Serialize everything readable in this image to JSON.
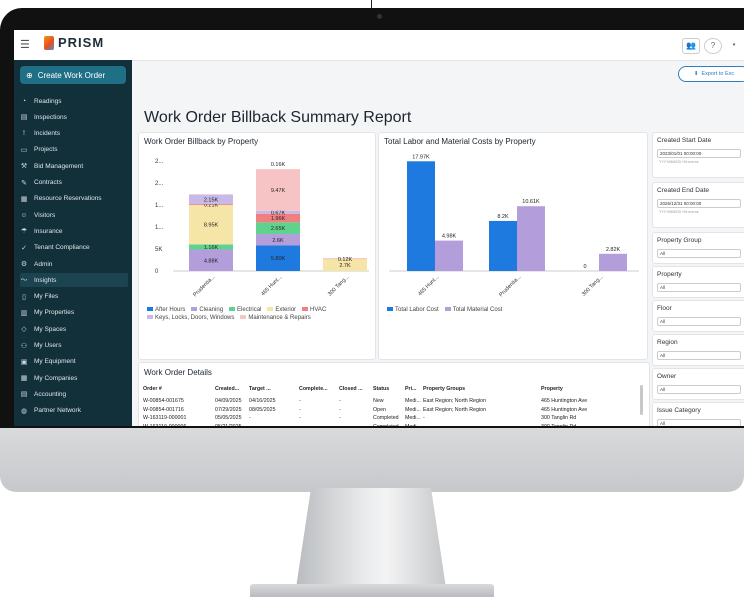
{
  "app": {
    "logo_text": "PRISM",
    "menu_icon": "menu-icon"
  },
  "sidebar": {
    "create_label": "Create Work Order",
    "items": [
      {
        "label": "Readings",
        "icon": "gauge-icon"
      },
      {
        "label": "Inspections",
        "icon": "clipboard-icon"
      },
      {
        "label": "Incidents",
        "icon": "alert-icon"
      },
      {
        "label": "Projects",
        "icon": "folder-icon"
      },
      {
        "label": "Bid Management",
        "icon": "gavel-icon"
      },
      {
        "label": "Contracts",
        "icon": "contract-icon"
      },
      {
        "label": "Resource Reservations",
        "icon": "calendar-icon"
      },
      {
        "label": "Visitors",
        "icon": "visitor-icon"
      },
      {
        "label": "Insurance",
        "icon": "umbrella-icon"
      },
      {
        "label": "Tenant Compliance",
        "icon": "check-circle-icon"
      },
      {
        "label": "Admin",
        "icon": "gear-icon"
      },
      {
        "label": "Insights",
        "icon": "trend-icon"
      },
      {
        "label": "My Files",
        "icon": "file-icon"
      },
      {
        "label": "My Properties",
        "icon": "building-icon"
      },
      {
        "label": "My Spaces",
        "icon": "space-icon"
      },
      {
        "label": "My Users",
        "icon": "users-icon"
      },
      {
        "label": "My Equipment",
        "icon": "equipment-icon"
      },
      {
        "label": "My Companies",
        "icon": "company-icon"
      },
      {
        "label": "Accounting",
        "icon": "ledger-icon"
      },
      {
        "label": "Partner Network",
        "icon": "globe-icon"
      }
    ]
  },
  "header": {
    "export_label": "Export to Exc"
  },
  "report": {
    "title": "Work Order Billback Summary Report"
  },
  "chart_data": [
    {
      "type": "bar",
      "title": "Work Order Billback by Property",
      "stacked": true,
      "categories": [
        "Prudentia...",
        "465 Hunt...",
        "300 Tang..."
      ],
      "y_ticks": [
        "0",
        "5K",
        "1...",
        "1...",
        "2...",
        "2..."
      ],
      "series": [
        {
          "name": "After Hours",
          "color": "#1f7ae0",
          "values": [
            0,
            5.8,
            0
          ],
          "labels": [
            "",
            "5.80K",
            ""
          ]
        },
        {
          "name": "Cleaning",
          "color": "#b39ddb",
          "values": [
            4.88,
            2.6,
            0
          ],
          "labels": [
            "4.88K",
            "2.6K",
            ""
          ]
        },
        {
          "name": "Electrical",
          "color": "#5fd38d",
          "values": [
            1.16,
            2.65,
            0
          ],
          "labels": [
            "1.16K",
            "2.65K",
            ""
          ]
        },
        {
          "name": "Exterior",
          "color": "#f5e6a8",
          "values": [
            8.95,
            0,
            2.7
          ],
          "labels": [
            "8.95K",
            "",
            "2.7K"
          ]
        },
        {
          "name": "HVAC",
          "color": "#f08080",
          "values": [
            0.21,
            1.96,
            0.12
          ],
          "labels": [
            "0.21K",
            "1.96K",
            "0.12K"
          ]
        },
        {
          "name": "Keys, Locks, Doors, Windows",
          "color": "#c9b9e8",
          "values": [
            2.15,
            0.67,
            0
          ],
          "labels": [
            "2.15K",
            "0.67K",
            ""
          ]
        },
        {
          "name": "Maintenance & Repairs",
          "color": "#f6c4c4",
          "values": [
            0.1,
            9.47,
            0
          ],
          "labels": [
            "",
            "9.47K",
            ""
          ]
        }
      ],
      "extra_labels": [
        {
          "category": "465 Hunt...",
          "text": "0.16K"
        }
      ]
    },
    {
      "type": "bar",
      "title": "Total Labor and Material Costs by Property",
      "categories": [
        "465 Hunt...",
        "Prudentia...",
        "300 Tang..."
      ],
      "series": [
        {
          "name": "Total Labor Cost",
          "color": "#1f7ae0",
          "values": [
            17.97,
            8.2,
            0
          ],
          "labels": [
            "17.97K",
            "8.2K",
            "0"
          ]
        },
        {
          "name": "Total Material Cost",
          "color": "#b39ddb",
          "values": [
            4.98,
            10.61,
            2.82
          ],
          "labels": [
            "4.98K",
            "10.61K",
            "2.82K"
          ]
        }
      ]
    }
  ],
  "filters": {
    "created_start": {
      "label": "Created Start Date",
      "value": "2023/01/01 00:00:00",
      "hint": "YYYY/MM/DD HH:mm:ss"
    },
    "created_end": {
      "label": "Created End Date",
      "value": "2026/12/31 00:00:00",
      "hint": "YYYY/MM/DD HH:mm:ss"
    },
    "selects": [
      {
        "label": "Property Group",
        "value": "All"
      },
      {
        "label": "Property",
        "value": "All"
      },
      {
        "label": "Floor",
        "value": "All"
      },
      {
        "label": "Region",
        "value": "All"
      },
      {
        "label": "Owner",
        "value": "All"
      },
      {
        "label": "Issue Category",
        "value": "All"
      }
    ]
  },
  "table": {
    "title": "Work Order Details",
    "columns": [
      "Order #",
      "Created...",
      "Target ...",
      "Complete...",
      "Closed ...",
      "Status",
      "Pri...",
      "Property Groups",
      "Property"
    ],
    "rows": [
      [
        "W-00854-001675",
        "04/09/2025",
        "04/16/2025",
        "-",
        "-",
        "New",
        "Medi...",
        "East Region; North Region",
        "465 Huntington Ave"
      ],
      [
        "W-00854-001716",
        "07/29/2025",
        "08/05/2025",
        "-",
        "-",
        "Open",
        "Medi...",
        "East Region; North Region",
        "465 Huntington Ave"
      ],
      [
        "W-163119-000001",
        "05/05/2025",
        "-",
        "-",
        "-",
        "Completed",
        "Medi...",
        "-",
        "300 Tanglin Rd"
      ],
      [
        "W-163119-000006",
        "05/21/2025",
        "-",
        "-",
        "-",
        "Completed",
        "Medi...",
        "-",
        "300 Tanglin Rd"
      ]
    ]
  }
}
